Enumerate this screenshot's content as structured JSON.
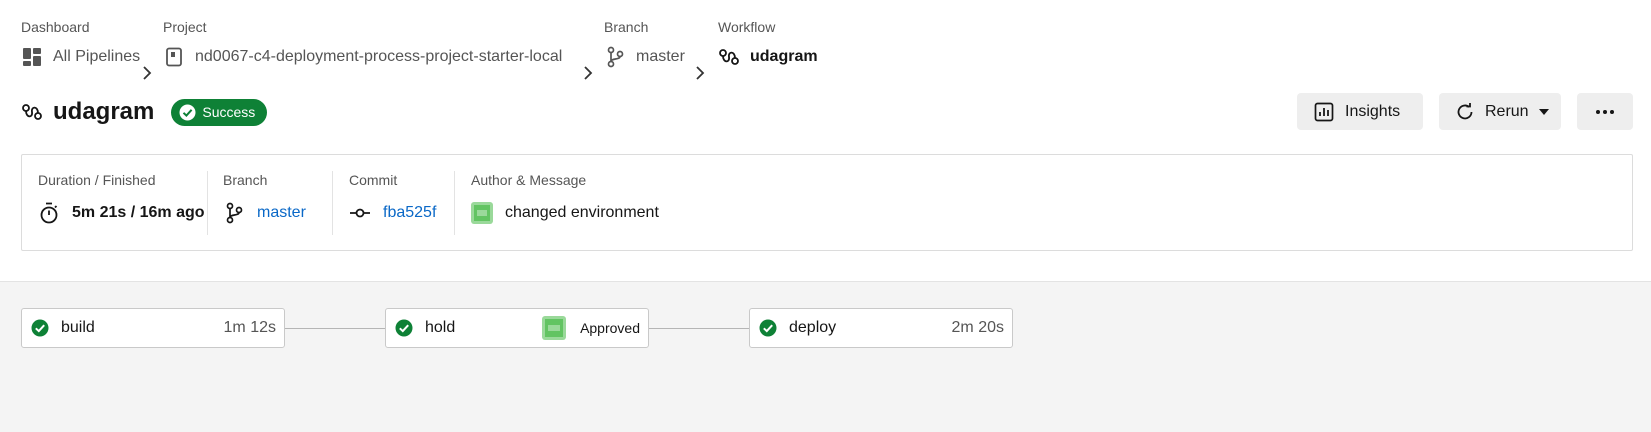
{
  "breadcrumbs": {
    "dashboard": {
      "label": "Dashboard",
      "value": "All Pipelines",
      "icon": "dashboard-grid-icon"
    },
    "project": {
      "label": "Project",
      "value": "nd0067-c4-deployment-process-project-starter-local",
      "icon": "repo-icon"
    },
    "branch": {
      "label": "Branch",
      "value": "master",
      "icon": "branch-icon"
    },
    "workflow": {
      "label": "Workflow",
      "value": "udagram",
      "icon": "workflow-icon"
    }
  },
  "header": {
    "title": "udagram",
    "status": "Success",
    "status_color": "#0e8136",
    "insights_label": "Insights",
    "rerun_label": "Rerun"
  },
  "summary": {
    "duration": {
      "label": "Duration / Finished",
      "value": "5m 21s / 16m ago"
    },
    "branch": {
      "label": "Branch",
      "value": "master"
    },
    "commit": {
      "label": "Commit",
      "value": "fba525f"
    },
    "author": {
      "label": "Author & Message",
      "message": "changed environment"
    }
  },
  "jobs": [
    {
      "name": "build",
      "duration": "1m 12s",
      "status": "success"
    },
    {
      "name": "hold",
      "approval": "Approved",
      "status": "success"
    },
    {
      "name": "deploy",
      "duration": "2m 20s",
      "status": "success"
    }
  ],
  "colors": {
    "accent_link": "#0a68c7",
    "success": "#0e8136",
    "avatar": "#62c462"
  }
}
